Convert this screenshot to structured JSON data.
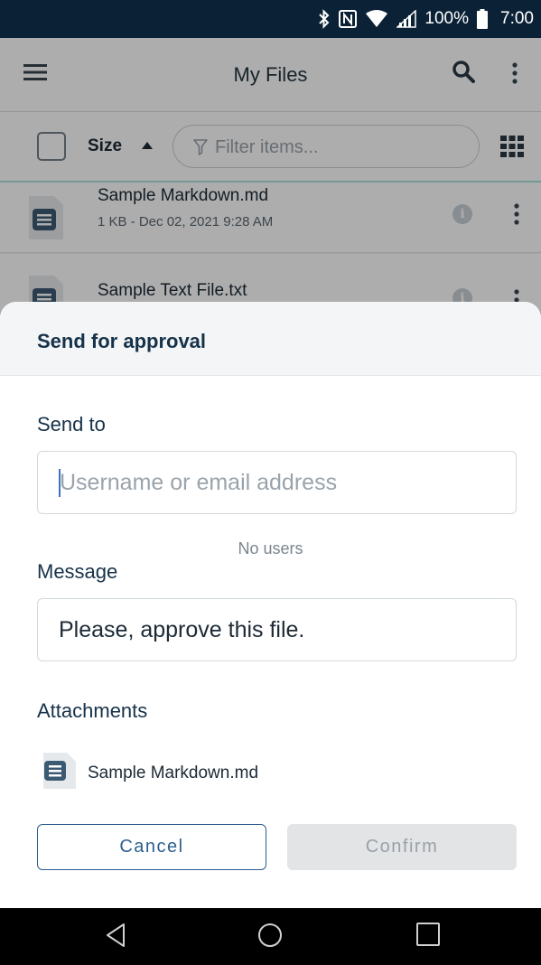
{
  "status_bar": {
    "battery": "100%",
    "time": "7:00",
    "icons": [
      "bluetooth-icon",
      "nfc-icon",
      "wifi-icon",
      "signal-icon",
      "battery-icon"
    ]
  },
  "app_bar": {
    "title": "My Files"
  },
  "toolbar": {
    "sort_label": "Size",
    "filter_placeholder": "Filter items..."
  },
  "files": [
    {
      "name": "Sample Markdown.md",
      "meta": "1 KB - Dec 02, 2021 9:28 AM"
    },
    {
      "name": "Sample Text File.txt",
      "meta": ""
    }
  ],
  "sheet": {
    "title": "Send for approval",
    "send_to_label": "Send to",
    "send_to_placeholder": "Username or email address",
    "send_to_value": "",
    "no_users": "No users",
    "message_label": "Message",
    "message_value": "Please, approve this file.",
    "attachments_label": "Attachments",
    "attachments": [
      {
        "name": "Sample Markdown.md"
      }
    ],
    "cancel_label": "Cancel",
    "confirm_label": "Confirm"
  },
  "colors": {
    "status_bar_bg": "#0b2236",
    "heading": "#16324a",
    "accent": "#2d5f8f",
    "caret": "#3a72c4",
    "disabled_bg": "#e2e4e6"
  }
}
